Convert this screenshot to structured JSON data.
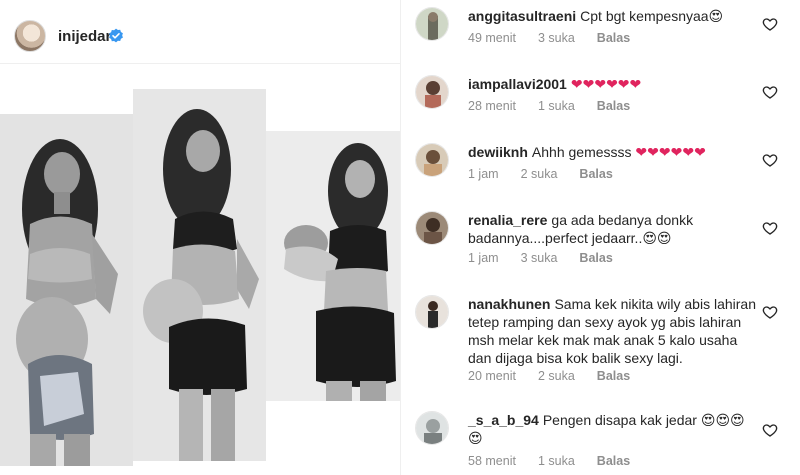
{
  "post": {
    "username": "inijedar",
    "verified_icon": "verified-badge-icon",
    "photos": [
      "photo-pregnant-front",
      "photo-pregnant-side",
      "photo-holding-baby"
    ]
  },
  "comments": [
    {
      "username": "anggitasultraeni",
      "text": "Cpt bgt kempesnyaa😍",
      "time": "49 menit",
      "likes": "3 suka",
      "reply": "Balas"
    },
    {
      "username": "iampallavi2001",
      "text": "❤❤❤❤❤❤",
      "time": "28 menit",
      "likes": "1 suka",
      "reply": "Balas"
    },
    {
      "username": "dewiiknh",
      "text": "Ahhh gemessss ❤❤❤❤❤❤",
      "time": "1 jam",
      "likes": "2 suka",
      "reply": "Balas"
    },
    {
      "username": "renalia_rere",
      "text": "ga ada bedanya donkk badannya....perfect jedaarr..😍😍",
      "time": "1 jam",
      "likes": "3 suka",
      "reply": "Balas"
    },
    {
      "username": "nanakhunen",
      "text": "Sama kek nikita wily abis lahiran tetep ramping dan sexy ayok yg abis lahiran msh melar kek mak mak anak 5 kalo usaha dan dijaga bisa kok balik sexy lagi.",
      "time": "20 menit",
      "likes": "2 suka",
      "reply": "Balas"
    },
    {
      "username": "_s_a_b_94",
      "text": "Pengen disapa kak jedar 😍😍😍😍",
      "time": "58 menit",
      "likes": "1 suka",
      "reply": "Balas"
    }
  ],
  "colors": {
    "verified": "#3897f0",
    "heart_empty": "#262626",
    "heart_emoji": "#e0245e",
    "meta": "#8e8e8e"
  }
}
